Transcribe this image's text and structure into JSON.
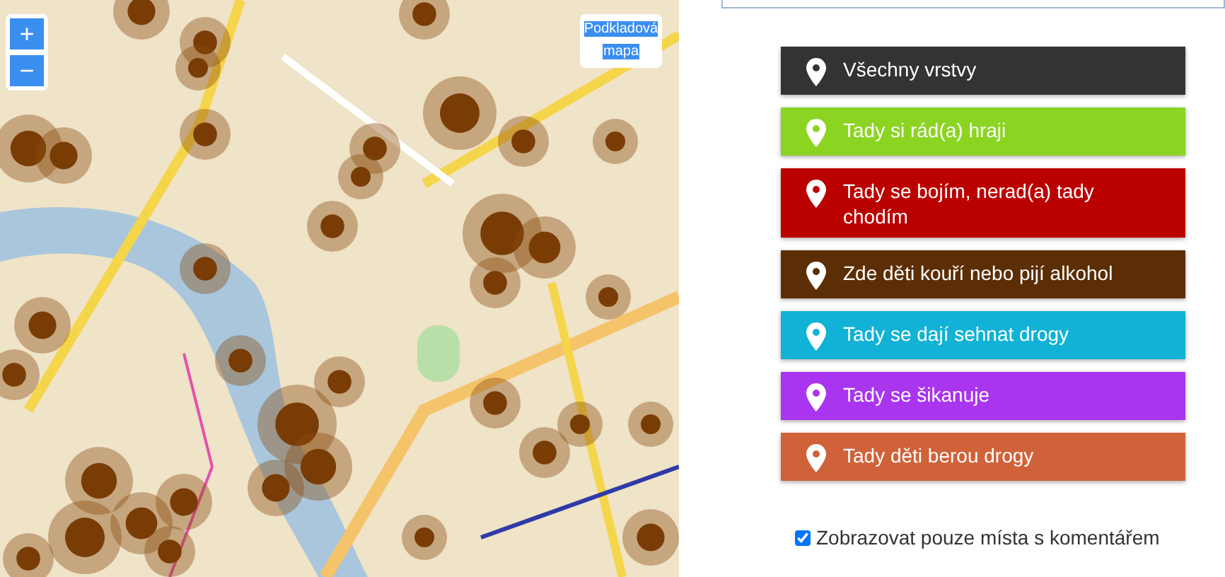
{
  "map": {
    "zoom_in": "+",
    "zoom_out": "−",
    "basemap_button": "Podkladová mapa"
  },
  "layers": [
    {
      "label": "Všechny vrstvy",
      "color": "#333333"
    },
    {
      "label": "Tady si rád(a) hraji",
      "color": "#8bd422"
    },
    {
      "label": "Tady se bojím, nerad(a) tady chodím",
      "color": "#bb0000"
    },
    {
      "label": "Zde děti kouří nebo pijí alkohol",
      "color": "#5c2e05"
    },
    {
      "label": "Tady se dají sehnat drogy",
      "color": "#11b2d6"
    },
    {
      "label": "Tady se šikanuje",
      "color": "#a935ee"
    },
    {
      "label": "Tady děti berou drogy",
      "color": "#d0623a"
    }
  ],
  "comments_only": {
    "label": "Zobrazovat pouze místa s komentářem",
    "checked": true
  }
}
